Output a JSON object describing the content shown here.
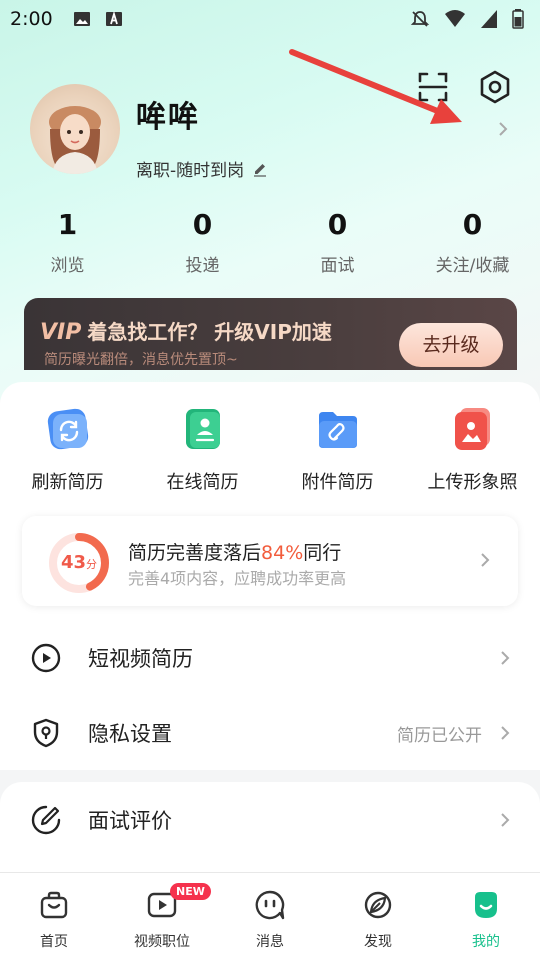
{
  "status_bar": {
    "time": "2:00"
  },
  "profile": {
    "name": "哞哞",
    "job_status": "离职-随时到岗"
  },
  "stats": [
    {
      "value": "1",
      "label": "浏览"
    },
    {
      "value": "0",
      "label": "投递"
    },
    {
      "value": "0",
      "label": "面试"
    },
    {
      "value": "0",
      "label": "关注/收藏"
    }
  ],
  "vip_banner": {
    "vip_word": "VIP",
    "title": "着急找工作？ 升级VIP加速",
    "subtitle": "简历曝光翻倍，消息优先置顶~",
    "button": "去升级"
  },
  "quick_actions": [
    {
      "label": "刷新简历",
      "icon": "refresh-resume-icon",
      "color": "#4a8ff5"
    },
    {
      "label": "在线简历",
      "icon": "online-resume-icon",
      "color": "#22b57a"
    },
    {
      "label": "附件简历",
      "icon": "attachment-resume-icon",
      "color": "#3e86f0"
    },
    {
      "label": "上传形象照",
      "icon": "upload-photo-icon",
      "color": "#f0524a"
    }
  ],
  "resume_completeness": {
    "score": "43",
    "score_unit": "分",
    "score_fraction": 0.43,
    "title_prefix": "简历完善度落后",
    "percent": "84%",
    "title_suffix": "同行",
    "subtitle": "完善4项内容，应聘成功率更高"
  },
  "menu": {
    "video_resume": "短视频简历",
    "privacy": "隐私设置",
    "privacy_value": "简历已公开",
    "interview_review": "面试评价"
  },
  "tabs": [
    {
      "label": "首页"
    },
    {
      "label": "视频职位",
      "badge": "NEW"
    },
    {
      "label": "消息"
    },
    {
      "label": "发现"
    },
    {
      "label": "我的",
      "active": true
    }
  ],
  "colors": {
    "accent": "#17c08c",
    "highlight": "#f25c3c",
    "badge": "#f5324d",
    "annotation_arrow": "#e8413c"
  }
}
